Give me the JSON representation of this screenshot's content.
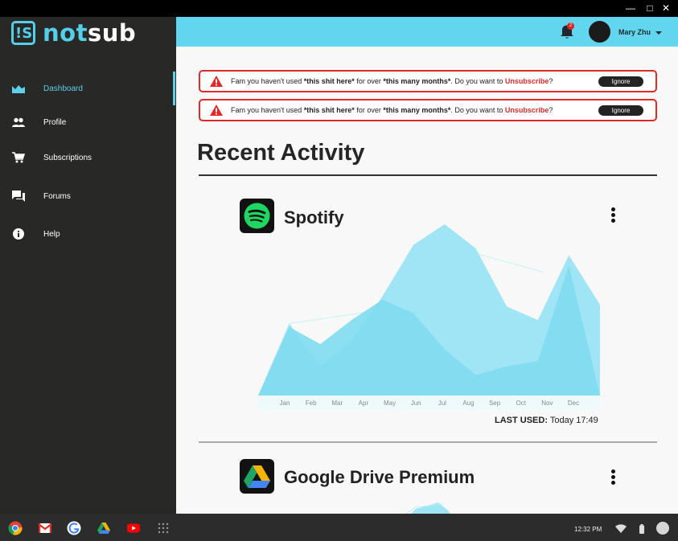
{
  "window": {
    "minimize_glyph": "—",
    "maximize_glyph": "□",
    "close_glyph": "✕"
  },
  "brand": {
    "logo_glyph": "!S",
    "name_part1": "not",
    "name_part2": "sub",
    "accent_color": "#55cfe9"
  },
  "sidebar": {
    "items": [
      {
        "label": "Dashboard",
        "icon": "chart-area-icon",
        "active": true
      },
      {
        "label": "Profile",
        "icon": "people-icon",
        "active": false
      },
      {
        "label": "Subscriptions",
        "icon": "cart-icon",
        "active": false
      },
      {
        "label": "Forums",
        "icon": "forum-icon",
        "active": false
      },
      {
        "label": "Help",
        "icon": "info-icon",
        "active": false
      }
    ]
  },
  "header": {
    "notification_count": "2",
    "user_name": "Mary Zhu",
    "bg_color": "#62d6ee"
  },
  "alerts": [
    {
      "prefix": "Fam you haven't used ",
      "item": "*this shit here*",
      "middle": " for over ",
      "duration": "*this many months*",
      "suffix": ". Do you want to ",
      "action": "Unsubscribe",
      "end": "?",
      "button": "Ignore"
    },
    {
      "prefix": "Fam you haven't used ",
      "item": "*this shit here*",
      "middle": " for over ",
      "duration": "*this many months*",
      "suffix": ". Do you want to ",
      "action": "Unsubscribe",
      "end": "?",
      "button": "Ignore"
    }
  ],
  "main": {
    "section_title": "Recent Activity",
    "cards": [
      {
        "name": "Spotify",
        "icon": "spotify-logo-icon",
        "last_used_label": "LAST USED:",
        "last_used_value": " Today 17:49"
      },
      {
        "name": "Google Drive Premium",
        "icon": "google-drive-logo-icon"
      }
    ]
  },
  "chart_data": {
    "type": "area",
    "categories": [
      "Jan",
      "Feb",
      "Mar",
      "Apr",
      "May",
      "Jun",
      "Jul",
      "Aug",
      "Sep",
      "Oct",
      "Nov",
      "Dec"
    ],
    "series": [
      {
        "values": [
          0,
          40,
          30,
          44,
          56,
          48,
          27,
          12,
          17,
          20,
          76,
          0
        ],
        "color": "#7fdaef"
      },
      {
        "values": [
          0,
          42,
          17,
          32,
          58,
          88,
          100,
          86,
          52,
          44,
          82,
          53
        ],
        "color": "#9fe5f5"
      }
    ],
    "ylim": [
      0,
      100
    ],
    "legend": "none",
    "grid": false
  },
  "taskbar": {
    "apps": [
      "chrome-icon",
      "gmail-icon",
      "google-icon",
      "drive-icon",
      "youtube-icon",
      "app-launcher-icon"
    ],
    "time": "12:32 PM"
  }
}
